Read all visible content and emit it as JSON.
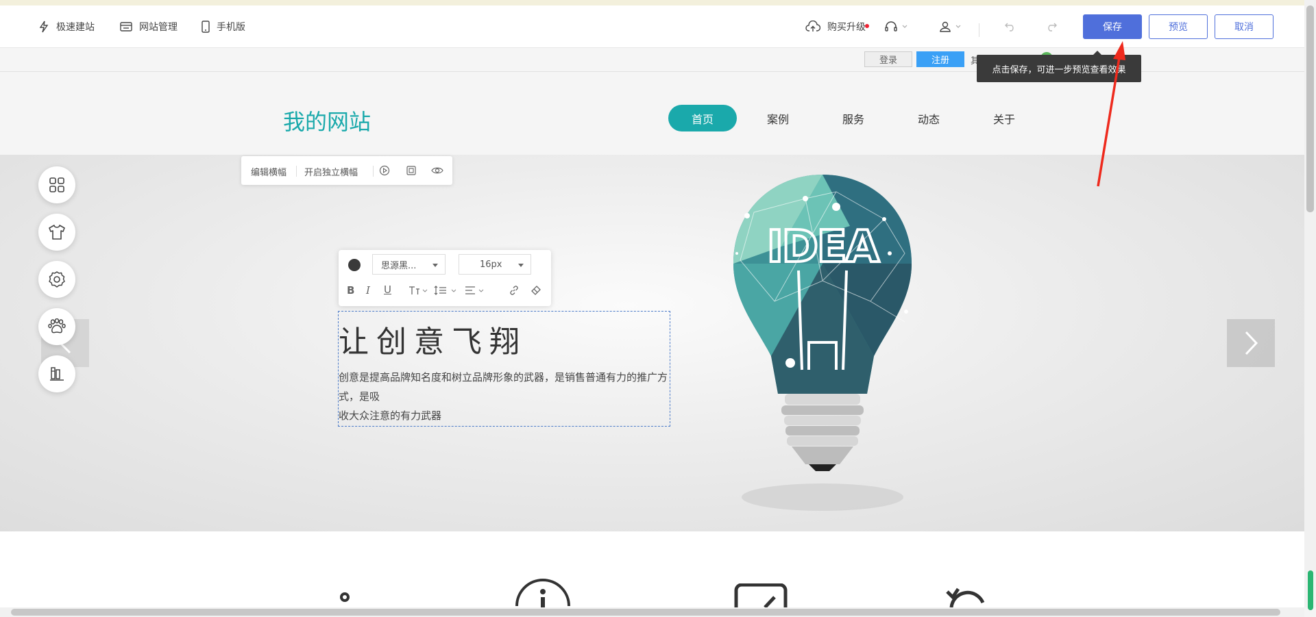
{
  "toolbar": {
    "quick_build": "极速建站",
    "site_manage": "网站管理",
    "mobile": "手机版",
    "upgrade": "购买升级",
    "save": "保存",
    "preview": "预览",
    "cancel": "取消"
  },
  "tooltip": "点击保存，可进一步预览查看效果",
  "subbar": {
    "login": "登录",
    "register": "注册",
    "partial": "其"
  },
  "site": {
    "logo": "我的网站",
    "nav": [
      {
        "label": "首页",
        "active": true
      },
      {
        "label": "案例"
      },
      {
        "label": "服务"
      },
      {
        "label": "动态"
      },
      {
        "label": "关于"
      }
    ]
  },
  "edit_bar": {
    "edit_banner": "编辑横幅",
    "independent": "开启独立横幅"
  },
  "format_bar": {
    "font": "思源黑...",
    "size": "16px"
  },
  "content": {
    "heading": "让创意飞翔",
    "para_line1": "创意是提高品牌知名度和树立品牌形象的武器，是销售普通有力的推广方式，是吸",
    "para_line2": "收大众注意的有力武器"
  },
  "colors": {
    "accent": "#1aa9ab",
    "primary": "#4f6fdb",
    "register": "#3aa0f6",
    "arrow": "#ee2a1d"
  }
}
